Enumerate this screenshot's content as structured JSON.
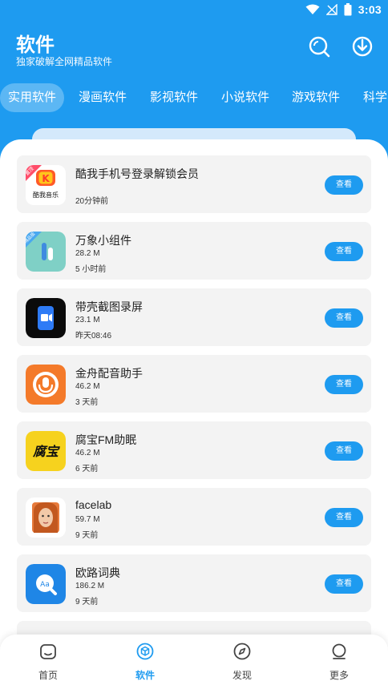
{
  "status_bar": {
    "time": "3:03"
  },
  "header": {
    "title": "软件",
    "subtitle": "独家破解全网精品软件"
  },
  "tabs": [
    {
      "label": "实用软件",
      "active": true
    },
    {
      "label": "漫画软件",
      "active": false
    },
    {
      "label": "影视软件",
      "active": false
    },
    {
      "label": "小说软件",
      "active": false
    },
    {
      "label": "游戏软件",
      "active": false
    },
    {
      "label": "科学",
      "active": false
    }
  ],
  "apps": [
    {
      "name": "酷我手机号登录解锁会员",
      "size": "",
      "time": "20分钟前",
      "button": "查看",
      "ribbon": "置顶",
      "icon_text": "酷我音乐"
    },
    {
      "name": "万象小组件",
      "size": "28.2 M",
      "time": "5 小时前",
      "button": "查看",
      "ribbon": "精品版"
    },
    {
      "name": "带壳截图录屏",
      "size": "23.1 M",
      "time": "昨天08:46",
      "button": "查看"
    },
    {
      "name": "金舟配音助手",
      "size": "46.2 M",
      "time": "3 天前",
      "button": "查看"
    },
    {
      "name": "腐宝FM助眠",
      "size": "46.2 M",
      "time": "6 天前",
      "button": "查看",
      "icon_text": "腐宝"
    },
    {
      "name": "facelab",
      "size": "59.7 M",
      "time": "9 天前",
      "button": "查看"
    },
    {
      "name": "欧路词典",
      "size": "186.2 M",
      "time": "9 天前",
      "button": "查看",
      "icon_text": "Aa"
    }
  ],
  "bottom_nav": [
    {
      "label": "首页",
      "icon": "home-icon",
      "active": false
    },
    {
      "label": "软件",
      "icon": "cube-icon",
      "active": true
    },
    {
      "label": "发现",
      "icon": "compass-icon",
      "active": false
    },
    {
      "label": "更多",
      "icon": "more-icon",
      "active": false
    }
  ],
  "colors": {
    "primary": "#1e9bf0",
    "card_bg": "#f3f3f3"
  }
}
